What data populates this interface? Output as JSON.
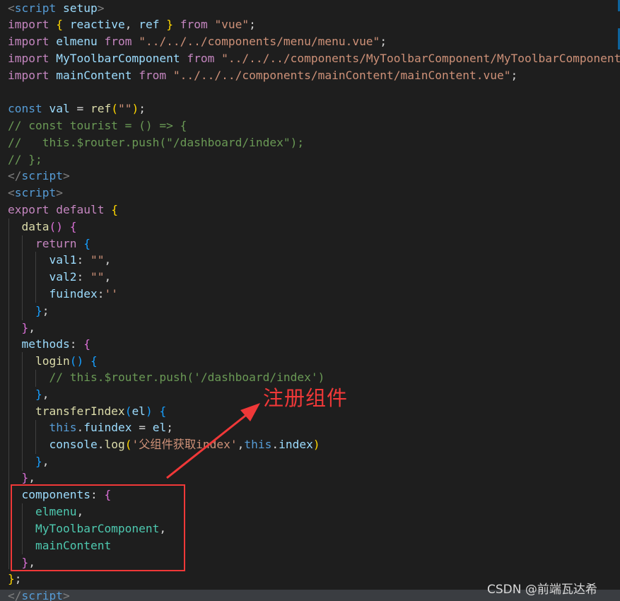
{
  "code": {
    "l1": {
      "open": "<",
      "name": "script",
      "attr": " setup",
      "close": ">"
    },
    "l2": {
      "kw": "import",
      "ob": " { ",
      "a": "reactive",
      "c": ", ",
      "b": "ref",
      "cb": " } ",
      "from": "from",
      "sp": " ",
      "path": "\"vue\"",
      "semi": ";"
    },
    "l3": {
      "kw": "import",
      "sp1": " ",
      "name": "elmenu",
      "sp2": " ",
      "from": "from",
      "sp3": " ",
      "path": "\"../../../components/menu/menu.vue\"",
      "semi": ";"
    },
    "l4": {
      "kw": "import",
      "sp1": " ",
      "name": "MyToolbarComponent",
      "sp2": " ",
      "from": "from",
      "sp3": " ",
      "path": "\"../../../components/MyToolbarComponent/MyToolbarComponent"
    },
    "l5": {
      "kw": "import",
      "sp1": " ",
      "name": "mainContent",
      "sp2": " ",
      "from": "from",
      "sp3": " ",
      "path": "\"../../../components/mainContent/mainContent.vue\"",
      "semi": ";"
    },
    "l7": {
      "kw": "const",
      "sp1": " ",
      "name": "val",
      "eq": " = ",
      "fn": "ref",
      "po": "(",
      "str": "\"\"",
      "pc": ")",
      "semi": ";"
    },
    "l8": "// const tourist = () => {",
    "l9": "//   this.$router.push(\"/dashboard/index\");",
    "l10": "// };",
    "l11": {
      "open": "</",
      "name": "script",
      "close": ">"
    },
    "l12": {
      "open": "<",
      "name": "script",
      "close": ">"
    },
    "l13": {
      "kw": "export default",
      "sp": " ",
      "brace": "{"
    },
    "l14": {
      "ind": "  ",
      "fn": "data",
      "pp": "()",
      "sp": " ",
      "brace": "{"
    },
    "l15": {
      "ind": "    ",
      "kw": "return",
      "sp": " ",
      "brace": "{"
    },
    "l16": {
      "ind": "      ",
      "key": "val1",
      "colon": ": ",
      "str": "\"\"",
      "comma": ","
    },
    "l17": {
      "ind": "      ",
      "key": "val2",
      "colon": ": ",
      "str": "\"\"",
      "comma": ","
    },
    "l18": {
      "ind": "      ",
      "key": "fuindex",
      "colon": ":",
      "str": "''"
    },
    "l19": {
      "ind": "    ",
      "brace": "}",
      "semi": ";"
    },
    "l20": {
      "ind": "  ",
      "brace": "}",
      "comma": ","
    },
    "l21": {
      "ind": "  ",
      "key": "methods",
      "colon": ": ",
      "brace": "{"
    },
    "l22": {
      "ind": "    ",
      "fn": "login",
      "pp": "()",
      "sp": " ",
      "brace": "{"
    },
    "l23": {
      "ind": "      ",
      "com": "// this.$router.push('/dashboard/index')"
    },
    "l24": {
      "ind": "    ",
      "brace": "}",
      "comma": ","
    },
    "l25": {
      "ind": "    ",
      "fn": "transferIndex",
      "po": "(",
      "arg": "el",
      "pc": ")",
      "sp": " ",
      "brace": "{"
    },
    "l26": {
      "ind": "      ",
      "this": "this",
      "dot": ".",
      "prop": "fuindex",
      "eq": " = ",
      "val": "el",
      "semi": ";"
    },
    "l27": {
      "ind": "      ",
      "obj": "console",
      "dot": ".",
      "fn": "log",
      "po": "(",
      "str": "'父组件获取index'",
      "comma": ",",
      "this": "this",
      "dot2": ".",
      "prop": "index",
      "pc": ")"
    },
    "l28": {
      "ind": "    ",
      "brace": "}",
      "comma": ","
    },
    "l29": {
      "ind": "  ",
      "brace": "}",
      "comma": ","
    },
    "l30": {
      "ind": "  ",
      "key": "components",
      "colon": ": ",
      "brace": "{"
    },
    "l31": {
      "ind": "    ",
      "name": "elmenu",
      "comma": ","
    },
    "l32": {
      "ind": "    ",
      "name": "MyToolbarComponent",
      "comma": ","
    },
    "l33": {
      "ind": "    ",
      "name": "mainContent"
    },
    "l34": {
      "ind": "  ",
      "brace": "}",
      "comma": ","
    },
    "l35": {
      "brace": "}",
      "semi": ";"
    },
    "l36": {
      "open": "</",
      "name": "script",
      "close": ">"
    }
  },
  "annotation": {
    "text": "注册组件"
  },
  "watermark": {
    "text": "CSDN @前端瓦达希"
  },
  "colors": {
    "background": "#1e1e1e",
    "keyword": "#c586c0",
    "string": "#ce9178",
    "comment": "#6a9955",
    "annotation": "#f03838"
  }
}
